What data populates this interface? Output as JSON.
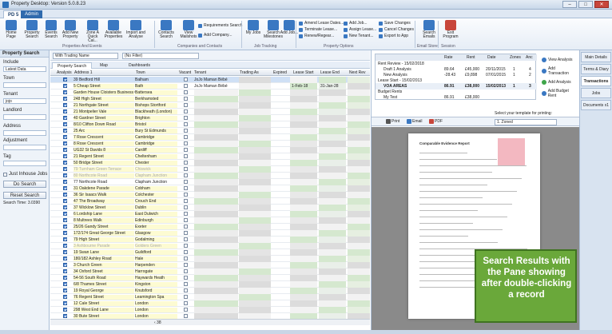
{
  "window": {
    "title": "Property Desktop: Version 5.0.8.23",
    "min": "–",
    "max": "□",
    "close": "✕"
  },
  "tabs": [
    {
      "label": "PD 5"
    },
    {
      "label": "Admin"
    }
  ],
  "ribbon": {
    "buttons": [
      {
        "label": "Home Page",
        "color": "#3a78c2",
        "icon": "home-icon"
      },
      {
        "label": "Property Search",
        "color": "#3a78c2",
        "icon": "building-icon"
      },
      {
        "label": "Events Search",
        "color": "#3a78c2",
        "icon": "calendar-icon"
      },
      {
        "label": "Add New Property",
        "color": "#3a78c2",
        "icon": "plus-building-icon"
      },
      {
        "label": "Zone A Quick Cal...",
        "color": "#3a78c2",
        "icon": "calculator-icon"
      },
      {
        "label": "Available Properties",
        "color": "#3a78c2",
        "icon": "list-icon"
      },
      {
        "label": "Import and Analyse",
        "color": "#3a78c2",
        "icon": "import-icon"
      },
      {
        "label": "Contacts Search",
        "color": "#3a78c2",
        "icon": "contacts-icon"
      },
      {
        "label": "View Mailshots",
        "color": "#3a78c2",
        "icon": "mail-icon"
      },
      {
        "label": "My Jobs",
        "color": "#3a78c2",
        "icon": "jobs-icon"
      },
      {
        "label": "Search Milestones",
        "color": "#3a78c2",
        "icon": "milestone-icon"
      },
      {
        "label": "Add Job...",
        "color": "#3a78c2",
        "icon": "add-job-icon"
      },
      {
        "label": "Search Emails",
        "color": "#3a78c2",
        "icon": "email-search-icon"
      },
      {
        "label": "Exit Program",
        "color": "#c8463b",
        "icon": "exit-icon"
      }
    ],
    "groups": [
      "Properties And Events",
      "Companies and Contacts",
      "Job Tracking",
      "Property Options",
      "Email Store",
      "Session"
    ],
    "contacts_small": [
      "Requirements Search",
      "Add Company..."
    ],
    "property_options_col1": [
      "Amend Lease Dates...",
      "Terminate Lease...",
      "Renew/Regear..."
    ],
    "property_options_col2": [
      "Add Job...",
      "Assign Lease...",
      "New Tenant..."
    ],
    "property_options_col3": [
      "Save Changes",
      "Cancel Changes",
      "Export to App"
    ]
  },
  "left": {
    "header": "Property Search",
    "include_label": "Include",
    "include_value": "Latest Data",
    "town_label": "Town",
    "tenant_label": "Tenant",
    "tenant_value": "jojo",
    "landlord_label": "Landlord",
    "address_label": "Address",
    "adjustment_label": "Adjustment",
    "tag_label": "Tag",
    "inhouse_label": "Just Inhouse Jobs",
    "do_search": "Do Search",
    "reset_search": "Reset Search",
    "search_time": "Search Time: 3.0390"
  },
  "center": {
    "filter1": "With Trading Name",
    "filter2": "(No Filter)",
    "subtabs": [
      "Property Search",
      "Map",
      "Dashboards"
    ],
    "headers": [
      "Analysis",
      "Address 1",
      "Town",
      "Vacant",
      "Tenant",
      "Trading As",
      "Expired",
      "Lease Start",
      "Lease End",
      "Next Rev"
    ],
    "rows": [
      {
        "a": "39 Bedford Hill",
        "t": "Balham",
        "tenant": "JoJo Maman Bébé",
        "ls": "",
        "le": "",
        "y": false,
        "f": false
      },
      {
        "a": "5 Cheap Street",
        "t": "Bath",
        "tenant": "JoJo Maman Bébé",
        "ls": "1-Feb-18",
        "le": "31-Jan-28",
        "y": true,
        "f": false
      },
      {
        "a": "Garden House Cloisters Business C...",
        "t": "Battersea",
        "tenant": "",
        "ls": "",
        "le": "",
        "y": true,
        "f": false
      },
      {
        "a": "248 High Street",
        "t": "Berkhamsted",
        "tenant": "",
        "ls": "",
        "le": "",
        "y": true,
        "f": false
      },
      {
        "a": "21 Northgate Street",
        "t": "Bishops Stortford",
        "tenant": "",
        "ls": "",
        "le": "",
        "y": true,
        "f": false
      },
      {
        "a": "21 Montpelier Vale",
        "t": "Blackheath (London)",
        "tenant": "",
        "ls": "",
        "le": "",
        "y": true,
        "f": false
      },
      {
        "a": "40 Gardner Street",
        "t": "Brighton",
        "tenant": "",
        "ls": "",
        "le": "",
        "y": true,
        "f": false
      },
      {
        "a": "8/10 Clifton Down Road",
        "t": "Bristol",
        "tenant": "",
        "ls": "",
        "le": "",
        "y": true,
        "f": false
      },
      {
        "a": "25 Arc",
        "t": "Bury St Edmunds",
        "tenant": "",
        "ls": "",
        "le": "",
        "y": true,
        "f": false
      },
      {
        "a": "7 Rose Crescent",
        "t": "Cambridge",
        "tenant": "",
        "ls": "",
        "le": "",
        "y": true,
        "f": false
      },
      {
        "a": "8 Rose Crescent",
        "t": "Cambridge",
        "tenant": "",
        "ls": "",
        "le": "",
        "y": true,
        "f": false
      },
      {
        "a": "UG32 St Davids 8",
        "t": "Cardiff",
        "tenant": "",
        "ls": "",
        "le": "",
        "y": true,
        "f": false
      },
      {
        "a": "21 Regent Street",
        "t": "Cheltenham",
        "tenant": "",
        "ls": "",
        "le": "",
        "y": true,
        "f": false
      },
      {
        "a": "50 Bridge Street",
        "t": "Chester",
        "tenant": "",
        "ls": "",
        "le": "",
        "y": true,
        "f": false
      },
      {
        "a": "79 Turnham Green Terrace",
        "t": "Chiswick",
        "tenant": "",
        "ls": "",
        "le": "",
        "y": true,
        "f": true
      },
      {
        "a": "80 Northcote Road",
        "t": "Clapham Junction",
        "tenant": "",
        "ls": "",
        "le": "",
        "y": true,
        "f": true
      },
      {
        "a": "77 Northcote Road",
        "t": "Clapham Junction",
        "tenant": "",
        "ls": "",
        "le": "",
        "y": false,
        "f": false
      },
      {
        "a": "31 Oakdene Parade",
        "t": "Cobham",
        "tenant": "",
        "ls": "",
        "le": "",
        "y": true,
        "f": false
      },
      {
        "a": "36 Sir Isaacs Walk",
        "t": "Colchester",
        "tenant": "",
        "ls": "",
        "le": "",
        "y": true,
        "f": false
      },
      {
        "a": "47 The Broadway",
        "t": "Crouch End",
        "tenant": "",
        "ls": "",
        "le": "",
        "y": true,
        "f": false
      },
      {
        "a": "37 Wicklow Street",
        "t": "Dublin",
        "tenant": "",
        "ls": "",
        "le": "",
        "y": true,
        "f": false
      },
      {
        "a": "6 Lordship Lane",
        "t": "East Dulwich",
        "tenant": "",
        "ls": "",
        "le": "",
        "y": true,
        "f": false
      },
      {
        "a": "8 Multrees Walk",
        "t": "Edinburgh",
        "tenant": "",
        "ls": "",
        "le": "",
        "y": true,
        "f": false
      },
      {
        "a": "25/26 Gandy Street",
        "t": "Exeter",
        "tenant": "",
        "ls": "",
        "le": "",
        "y": true,
        "f": false
      },
      {
        "a": "172/174 Great George Street",
        "t": "Glasgow",
        "tenant": "",
        "ls": "",
        "le": "",
        "y": true,
        "f": false
      },
      {
        "a": "79 High Street",
        "t": "Godalming",
        "tenant": "",
        "ls": "",
        "le": "",
        "y": true,
        "f": false
      },
      {
        "a": "3 Ashbourne Parade",
        "t": "Golders Green",
        "tenant": "",
        "ls": "",
        "le": "",
        "y": true,
        "f": true
      },
      {
        "a": "19 Swan Lane",
        "t": "Guildford",
        "tenant": "",
        "ls": "",
        "le": "",
        "y": true,
        "f": false
      },
      {
        "a": "180/182 Ashley Road",
        "t": "Hale",
        "tenant": "",
        "ls": "",
        "le": "",
        "y": true,
        "f": false
      },
      {
        "a": "3 Church Green",
        "t": "Harpenden",
        "tenant": "",
        "ls": "",
        "le": "",
        "y": true,
        "f": false
      },
      {
        "a": "34 Oxford Street",
        "t": "Harrogate",
        "tenant": "",
        "ls": "",
        "le": "",
        "y": true,
        "f": false
      },
      {
        "a": "54-56 South Road",
        "t": "Haywards Heath",
        "tenant": "",
        "ls": "",
        "le": "",
        "y": true,
        "f": false
      },
      {
        "a": "6/8 Thames Street",
        "t": "Kingston",
        "tenant": "",
        "ls": "",
        "le": "",
        "y": true,
        "f": false
      },
      {
        "a": "19 Royal George",
        "t": "Knutsford",
        "tenant": "",
        "ls": "",
        "le": "",
        "y": true,
        "f": false
      },
      {
        "a": "76 Regent Street",
        "t": "Leamington Spa",
        "tenant": "",
        "ls": "",
        "le": "",
        "y": true,
        "f": false
      },
      {
        "a": "12 Cale Street",
        "t": "London",
        "tenant": "",
        "ls": "",
        "le": "",
        "y": true,
        "f": false
      },
      {
        "a": "298 West End Lane",
        "t": "London",
        "tenant": "",
        "ls": "",
        "le": "",
        "y": true,
        "f": false
      },
      {
        "a": "30 Bute Street",
        "t": "London",
        "tenant": "",
        "ls": "",
        "le": "",
        "y": true,
        "f": false
      }
    ],
    "scroll_label": "‹ 38"
  },
  "right": {
    "headers": [
      "",
      "Rate",
      "Rent",
      "Date",
      "Zones",
      "Anc"
    ],
    "rows": [
      {
        "name": "Rent Review - 15/02/2018",
        "rate": "",
        "rent": "",
        "date": "",
        "zones": "",
        "anc": "",
        "bold": false
      },
      {
        "name": "Draft 1 Analysis",
        "rate": "89.64",
        "rent": "£45,000",
        "date": "20/11/2015",
        "zones": "1",
        "anc": "4",
        "bold": false
      },
      {
        "name": "New Analysis",
        "rate": "-28.43",
        "rent": "£9,898",
        "date": "07/01/2015",
        "zones": "1",
        "anc": "2",
        "bold": false
      },
      {
        "name": "Lease Start - 15/02/2013",
        "rate": "",
        "rent": "",
        "date": "",
        "zones": "",
        "anc": "",
        "bold": false
      },
      {
        "name": "VOA AREAS",
        "rate": "86.91",
        "rent": "£38,000",
        "date": "15/02/2013",
        "zones": "1",
        "anc": "3",
        "bold": true
      },
      {
        "name": "Budget Rents",
        "rate": "",
        "rent": "",
        "date": "",
        "zones": "",
        "anc": "",
        "bold": false
      },
      {
        "name": "My Test",
        "rate": "86.91",
        "rent": "£38,000",
        "date": "",
        "zones": "",
        "anc": "",
        "bold": false
      }
    ],
    "actions": [
      "View Analysis",
      "Add Transaction",
      "Add Analysis",
      "Add Budget Rent"
    ],
    "template_label": "Select your template for printing:",
    "template_value": "1. Zoned",
    "toolbar": [
      "Print",
      "Email",
      "PDF"
    ],
    "doc_title": "Comparable Evidence Report"
  },
  "tabs_right": [
    "Main Details",
    "Terms & Diary",
    "Transactions",
    "Jobs",
    "Documents x1"
  ],
  "callout": "Search Results with the Pane showing after double-clicking a record"
}
